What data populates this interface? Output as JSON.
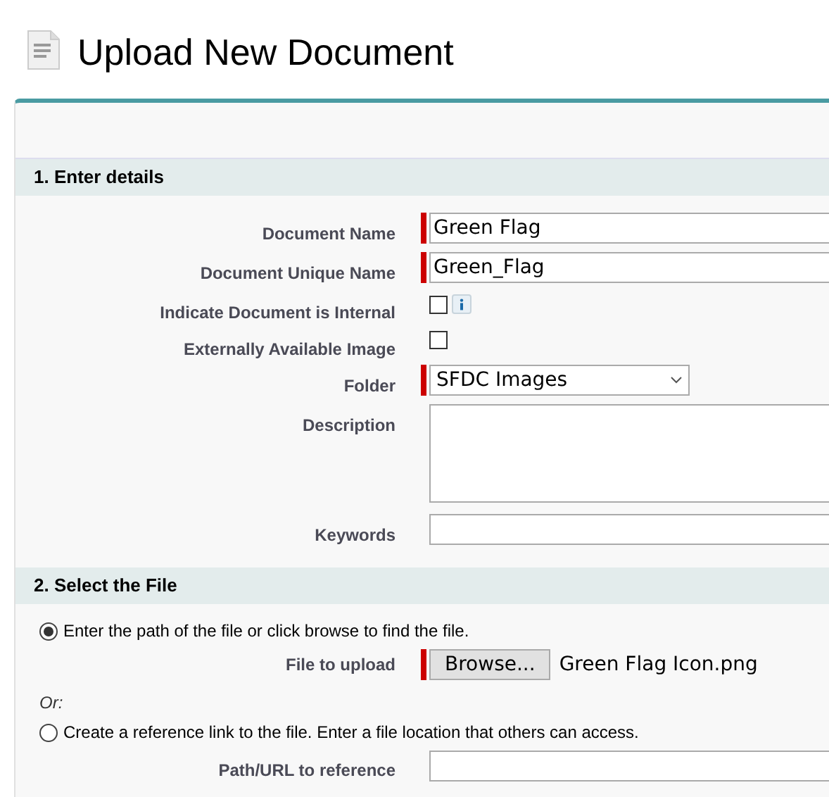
{
  "page_title": "Upload New Document",
  "section_1": {
    "title": "1. Enter details",
    "fields": [
      {
        "kind": "text",
        "label": "Document Name",
        "value": "Green Flag",
        "required": true
      },
      {
        "kind": "text",
        "label": "Document Unique Name",
        "value": "Green_Flag",
        "required": true
      },
      {
        "kind": "checkbox",
        "label": "Indicate Document is Internal",
        "checked": false,
        "info": true
      },
      {
        "kind": "checkbox",
        "label": "Externally Available Image",
        "checked": false,
        "info": false
      },
      {
        "kind": "select",
        "label": "Folder",
        "value": "SFDC Images",
        "required": true
      },
      {
        "kind": "textarea",
        "label": "Description",
        "required": false
      },
      {
        "kind": "text",
        "label": "Keywords",
        "required": false
      }
    ]
  },
  "section_2": {
    "title": "2. Select the File",
    "option_1": {
      "label": "Enter the path of the file or click browse to find the file.",
      "selected": true
    },
    "file_label": "File to upload",
    "browse_button": "Browse...",
    "file_name": "Green Flag Icon.png",
    "or_label": "Or:",
    "option_2": {
      "label": "Create a reference link to the file. Enter a file location that others can access.",
      "selected": false
    },
    "path_label": "Path/URL to reference"
  }
}
